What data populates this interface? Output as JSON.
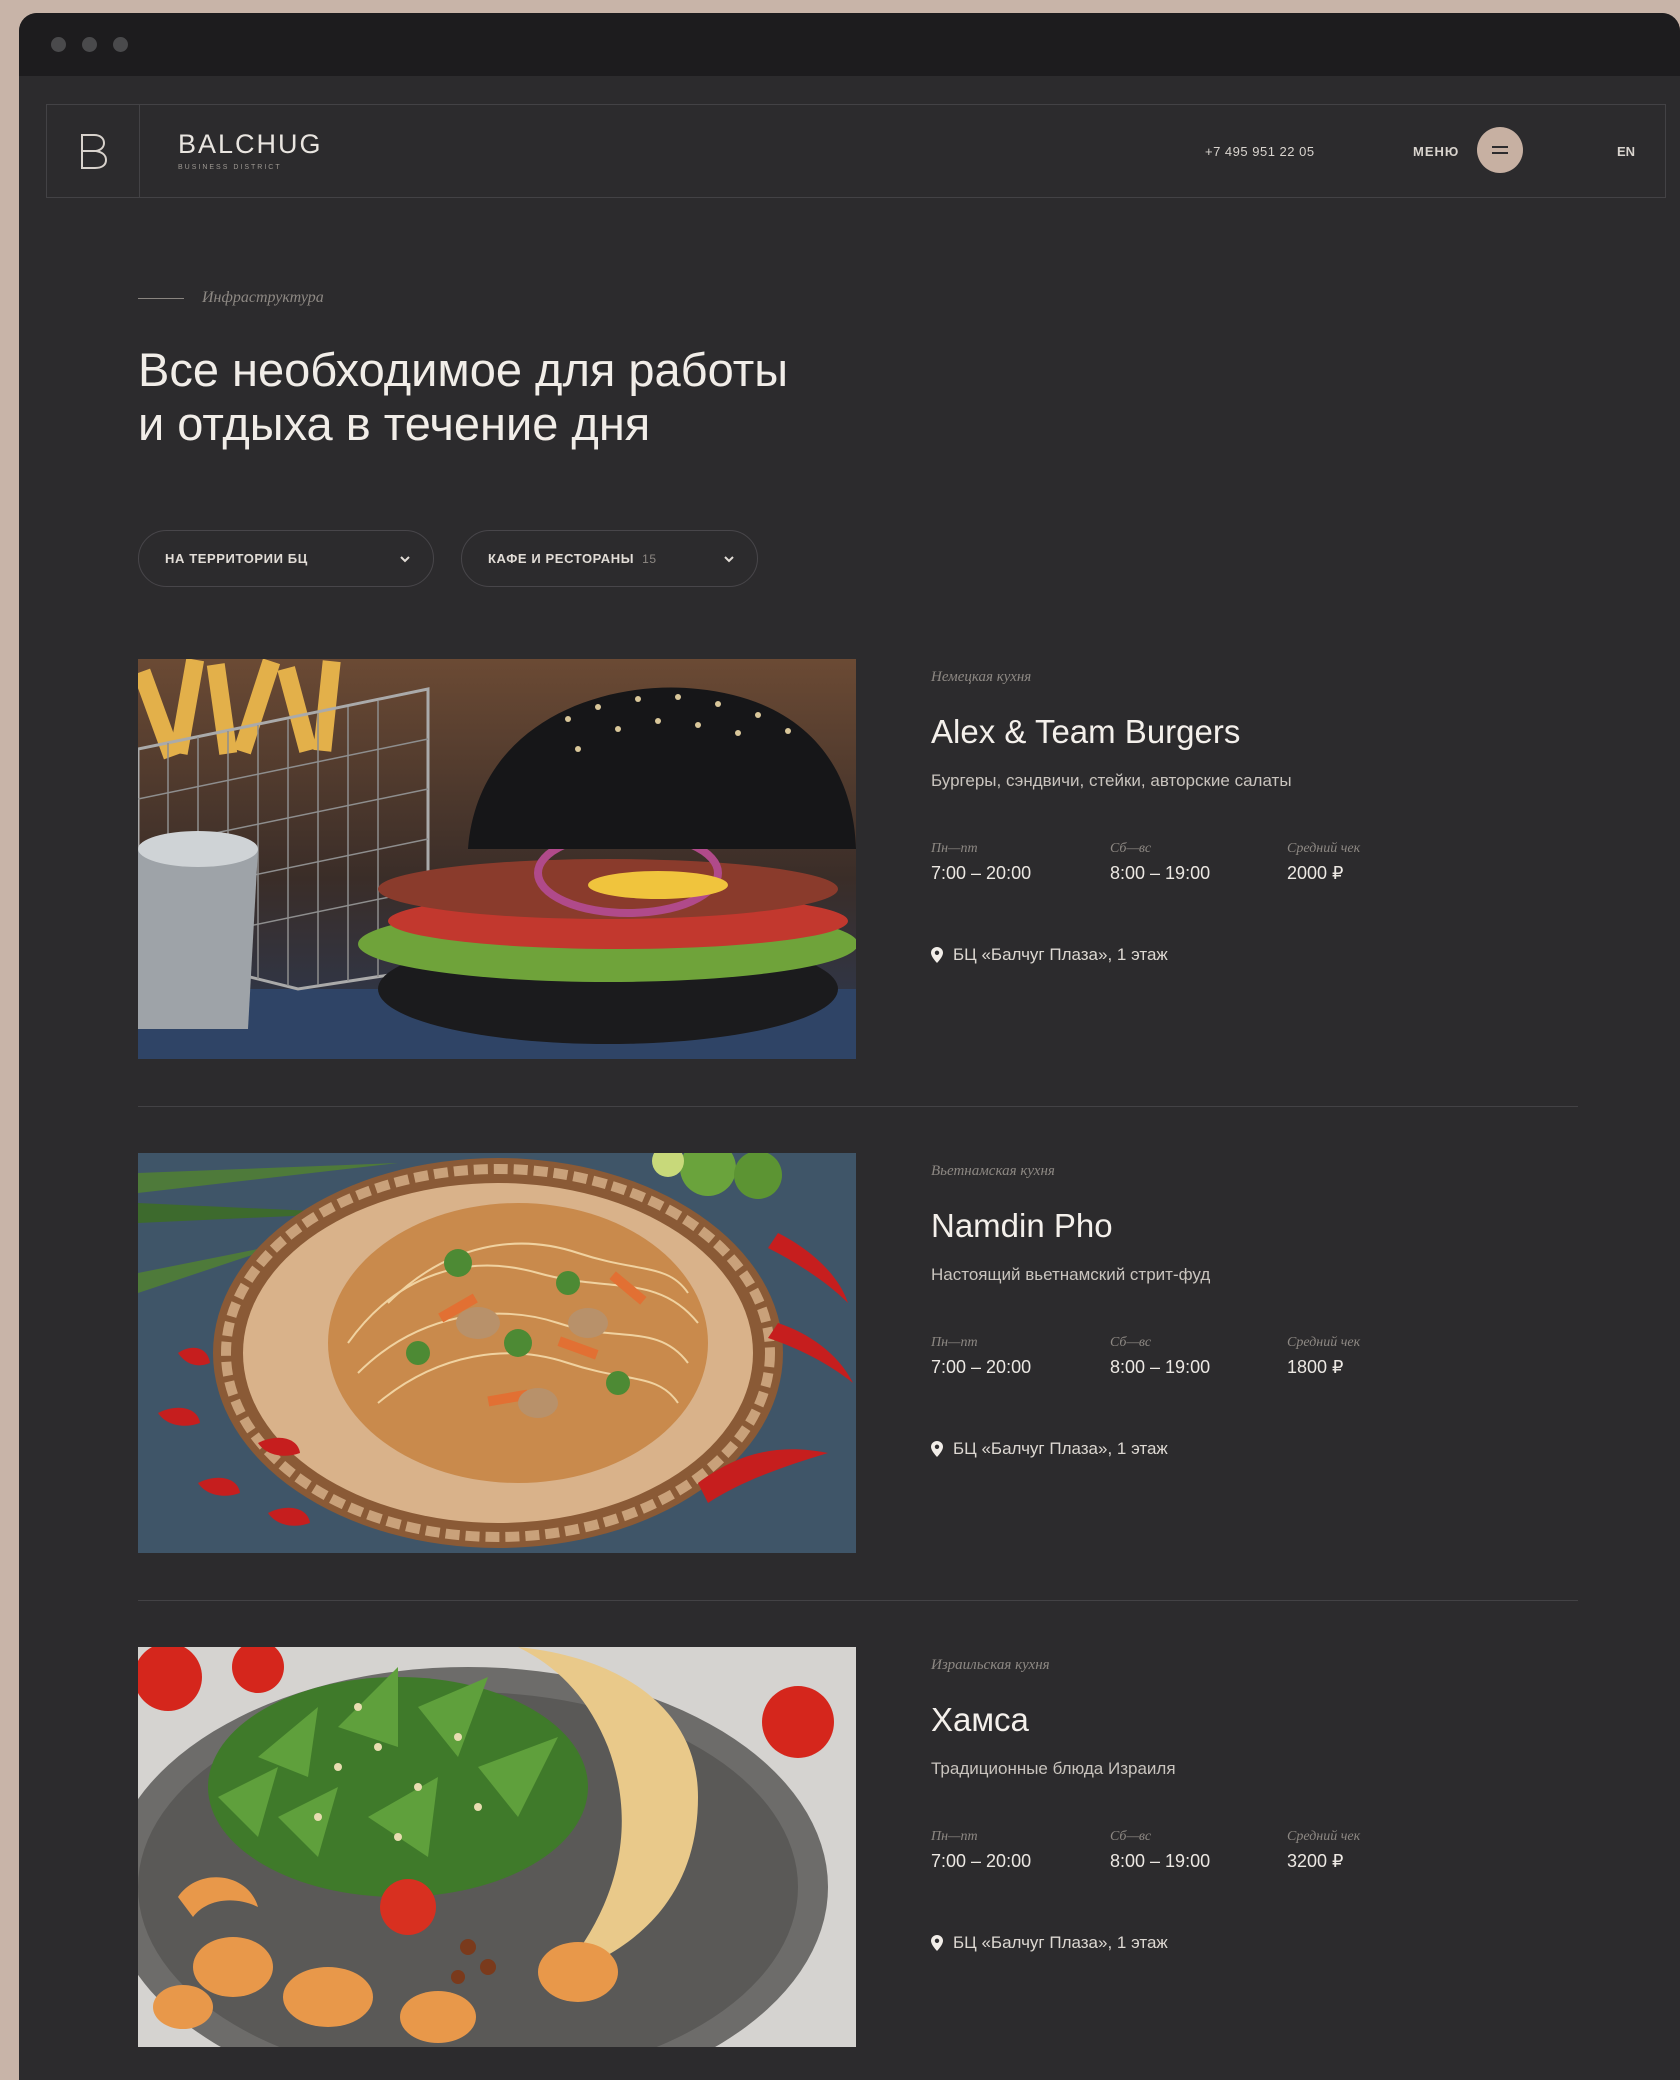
{
  "header": {
    "brand_name": "BALCHUG",
    "brand_sub": "BUSINESS DISTRICT",
    "phone": "+7 495 951 22 05",
    "menu_label": "МЕНЮ",
    "lang": "EN"
  },
  "section": {
    "eyebrow": "Инфраструктура",
    "headline_line1": "Все необходимое для работы",
    "headline_line2": "и отдыха в течение дня"
  },
  "filters": [
    {
      "label": "НА ТЕРРИТОРИИ БЦ",
      "count": ""
    },
    {
      "label": "КАФЕ И РЕСТОРАНЫ",
      "count": "15"
    }
  ],
  "labels": {
    "weekdays": "Пн—пт",
    "weekend": "Сб—вс",
    "avg_check": "Средний чек"
  },
  "venues": [
    {
      "cuisine": "Немецкая кухня",
      "name": "Alex & Team Burgers",
      "description": "Бургеры, сэндвичи, стейки, авторские салаты",
      "weekdays_hours": "7:00 – 20:00",
      "weekend_hours": "8:00 – 19:00",
      "avg_check": "2000 ₽",
      "address": "БЦ «Балчуг Плаза», 1 этаж"
    },
    {
      "cuisine": "Вьетнамская кухня",
      "name": "Namdin Pho",
      "description": "Настоящий вьетнамский стрит-фуд",
      "weekdays_hours": "7:00 – 20:00",
      "weekend_hours": "8:00 – 19:00",
      "avg_check": "1800 ₽",
      "address": "БЦ «Балчуг Плаза», 1 этаж"
    },
    {
      "cuisine": "Израильская кухня",
      "name": "Хамса",
      "description": "Традиционные блюда Израиля",
      "weekdays_hours": "7:00 – 20:00",
      "weekend_hours": "8:00 – 19:00",
      "avg_check": "3200 ₽",
      "address": "БЦ «Балчуг Плаза», 1 этаж"
    }
  ]
}
